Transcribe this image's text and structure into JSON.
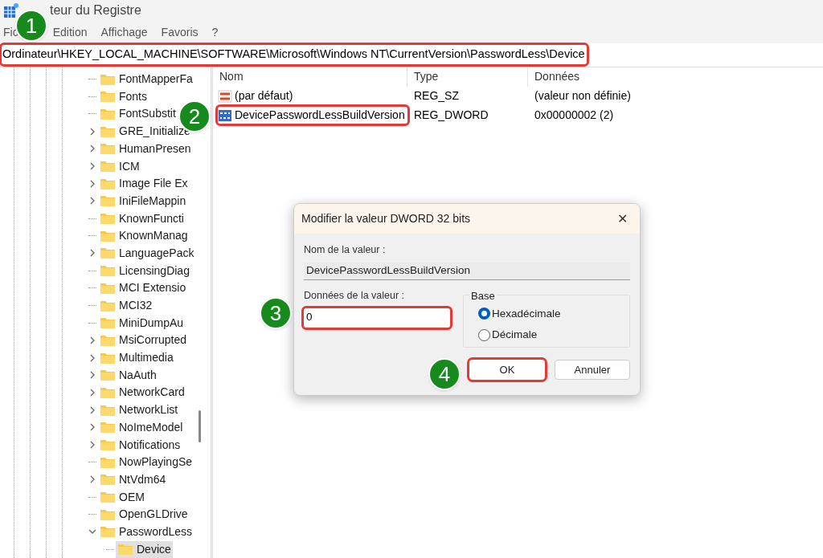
{
  "window": {
    "title": "teur du Registre"
  },
  "menu": [
    {
      "label": "Fic"
    },
    {
      "label": "Edition"
    },
    {
      "label": "Affichage"
    },
    {
      "label": "Favoris"
    },
    {
      "label": "?"
    }
  ],
  "address_bar": {
    "value": "Ordinateur\\HKEY_LOCAL_MACHINE\\SOFTWARE\\Microsoft\\Windows NT\\CurrentVersion\\PasswordLess\\Device",
    "highlighted": true
  },
  "tree": [
    {
      "label": "FontMapperFa",
      "kind": "leaf",
      "selected": false
    },
    {
      "label": "Fonts",
      "kind": "leaf",
      "selected": false
    },
    {
      "label": "FontSubstit",
      "kind": "leaf",
      "selected": false
    },
    {
      "label": "GRE_Initialize",
      "kind": "collapsed",
      "selected": false
    },
    {
      "label": "HumanPresen",
      "kind": "collapsed",
      "selected": false
    },
    {
      "label": "ICM",
      "kind": "collapsed",
      "selected": false
    },
    {
      "label": "Image File Ex",
      "kind": "collapsed",
      "selected": false
    },
    {
      "label": "IniFileMappin",
      "kind": "collapsed",
      "selected": false
    },
    {
      "label": "KnownFuncti",
      "kind": "leaf",
      "selected": false
    },
    {
      "label": "KnownManag",
      "kind": "leaf",
      "selected": false
    },
    {
      "label": "LanguagePack",
      "kind": "collapsed",
      "selected": false
    },
    {
      "label": "LicensingDiag",
      "kind": "leaf",
      "selected": false
    },
    {
      "label": "MCI Extensio",
      "kind": "leaf",
      "selected": false
    },
    {
      "label": "MCI32",
      "kind": "leaf",
      "selected": false
    },
    {
      "label": "MiniDumpAu",
      "kind": "leaf",
      "selected": false
    },
    {
      "label": "MsiCorrupted",
      "kind": "collapsed",
      "selected": false
    },
    {
      "label": "Multimedia",
      "kind": "collapsed",
      "selected": false
    },
    {
      "label": "NaAuth",
      "kind": "collapsed",
      "selected": false
    },
    {
      "label": "NetworkCard",
      "kind": "collapsed",
      "selected": false
    },
    {
      "label": "NetworkList",
      "kind": "collapsed",
      "selected": false
    },
    {
      "label": "NoImeModel",
      "kind": "collapsed",
      "selected": false
    },
    {
      "label": "Notifications",
      "kind": "collapsed",
      "selected": false
    },
    {
      "label": "NowPlayingSe",
      "kind": "leaf",
      "selected": false
    },
    {
      "label": "NtVdm64",
      "kind": "collapsed",
      "selected": false
    },
    {
      "label": "OEM",
      "kind": "leaf",
      "selected": false
    },
    {
      "label": "OpenGLDrive",
      "kind": "leaf",
      "selected": false
    },
    {
      "label": "PasswordLess",
      "kind": "expanded",
      "selected": false,
      "children": [
        {
          "label": "Device",
          "kind": "leaf",
          "selected": true
        }
      ]
    }
  ],
  "values_table": {
    "columns": [
      "Nom",
      "Type",
      "Données"
    ],
    "rows": [
      {
        "kind": "string",
        "name": "(par défaut)",
        "type": "REG_SZ",
        "data": "(valeur non définie)",
        "highlighted": false
      },
      {
        "kind": "binary",
        "name": "DevicePasswordLessBuildVersion",
        "type": "REG_DWORD",
        "data": "0x00000002 (2)",
        "highlighted": true
      }
    ]
  },
  "dialog": {
    "title": "Modifier la valeur DWORD 32 bits",
    "close": "✕",
    "name_label": "Nom de la valeur :",
    "name_value": "DevicePasswordLessBuildVersion",
    "data_label": "Données de la valeur :",
    "data_value": "0",
    "data_highlighted": true,
    "base_label": "Base",
    "bases": [
      {
        "label": "Hexadécimale",
        "selected": true
      },
      {
        "label": "Décimale",
        "selected": false
      }
    ],
    "buttons": [
      {
        "label": "OK",
        "highlighted": true
      },
      {
        "label": "Annuler",
        "highlighted": false
      }
    ]
  },
  "step_badges": [
    "1",
    "2",
    "3",
    "4"
  ]
}
